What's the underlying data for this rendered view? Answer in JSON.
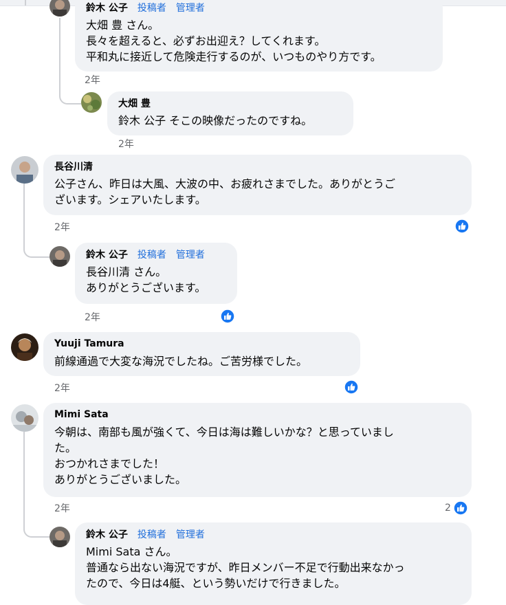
{
  "c1": {
    "name": "鈴木 公子",
    "badge1": "投稿者",
    "badge2": "管理者",
    "text": "大畑 豊 さん。\n長々を超えると、必ずお出迎え？してくれます。\n平和丸に接近して危険走行するのが、いつものやり方です。",
    "time": "2年"
  },
  "c2": {
    "name": "大畑 豊",
    "text": "鈴木 公子 そこの映像だったのですね。",
    "time": "2年"
  },
  "c3": {
    "name": "長谷川清",
    "text": "公子さん、昨日は大風、大波の中、お疲れさまでした。ありがとうご\nざいます。シェアいたします。",
    "time": "2年"
  },
  "c4": {
    "name": "鈴木 公子",
    "badge1": "投稿者",
    "badge2": "管理者",
    "text": "長谷川清 さん。\nありがとうございます。",
    "time": "2年"
  },
  "c5": {
    "name": "Yuuji Tamura",
    "text": "前線通過で大変な海況でしたね。ご苦労様でした。",
    "time": "2年"
  },
  "c6": {
    "name": "Mimi Sata",
    "text": "今朝は、南部も風が強くて、今日は海は難しいかな？と思っていまし\nた。\nおつかれさまでした！\nありがとうございました。",
    "time": "2年",
    "reactions": "2"
  },
  "c7": {
    "name": "鈴木 公子",
    "badge1": "投稿者",
    "badge2": "管理者",
    "text": "Mimi Sata さん。\n普通なら出ない海況ですが、昨日メンバー不足で行動出来なかっ\nたので、今日は4艇、という勢いだけで行きました。"
  },
  "colors": {
    "bubble": "#f0f2f5",
    "badge": "#216fdb",
    "like": "#1877f2",
    "meta": "#65676b"
  }
}
